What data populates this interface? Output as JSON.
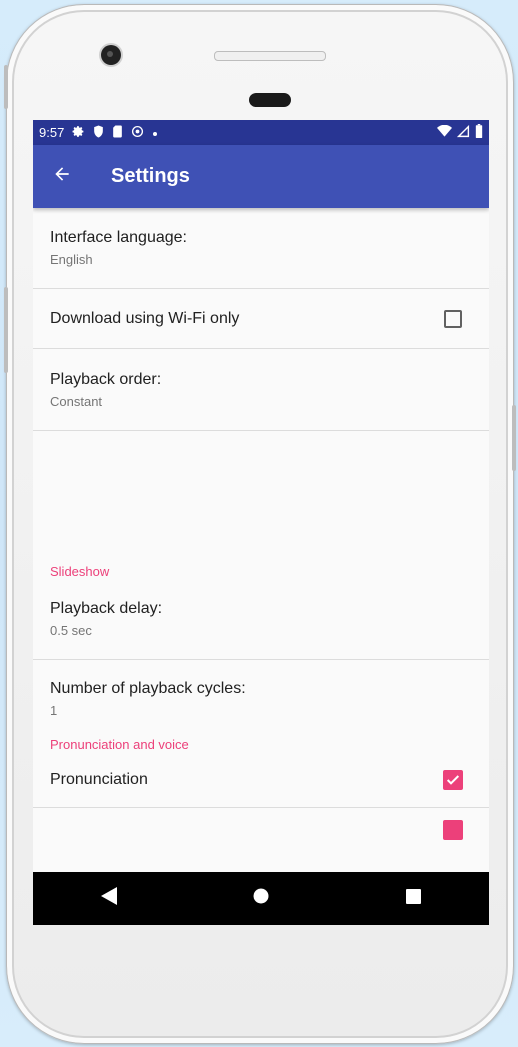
{
  "status_bar": {
    "time": "9:57",
    "left_icons": [
      "settings-icon",
      "shield-icon",
      "sim-card-icon",
      "sync-icon",
      "notification-dot-icon"
    ],
    "right_icons": [
      "wifi-icon",
      "signal-icon",
      "battery-icon"
    ]
  },
  "app_bar": {
    "back_icon": "arrow-left-icon",
    "title": "Settings"
  },
  "preferences": {
    "interface_language": {
      "title": "Interface language:",
      "summary": "English"
    },
    "wifi_only": {
      "title": "Download using Wi-Fi only",
      "checked": false
    },
    "playback_order": {
      "title": "Playback order:",
      "summary": "Constant"
    },
    "slideshow_category": "Slideshow",
    "playback_delay": {
      "title": "Playback delay:",
      "summary": "0.5 sec"
    },
    "playback_cycles": {
      "title": "Number of playback cycles:",
      "summary": "1"
    },
    "pronunciation_category": "Pronunciation and voice",
    "pronunciation": {
      "title": "Pronunciation",
      "checked": true
    },
    "partial_next_item": {
      "checked": true
    }
  },
  "nav_bar": {
    "back_icon": "triangle-back-icon",
    "home_icon": "circle-home-icon",
    "recents_icon": "square-recents-icon"
  },
  "colors": {
    "status_bar": "#283593",
    "app_bar": "#3f51b5",
    "accent": "#ec407a",
    "background": "#fafafa"
  }
}
